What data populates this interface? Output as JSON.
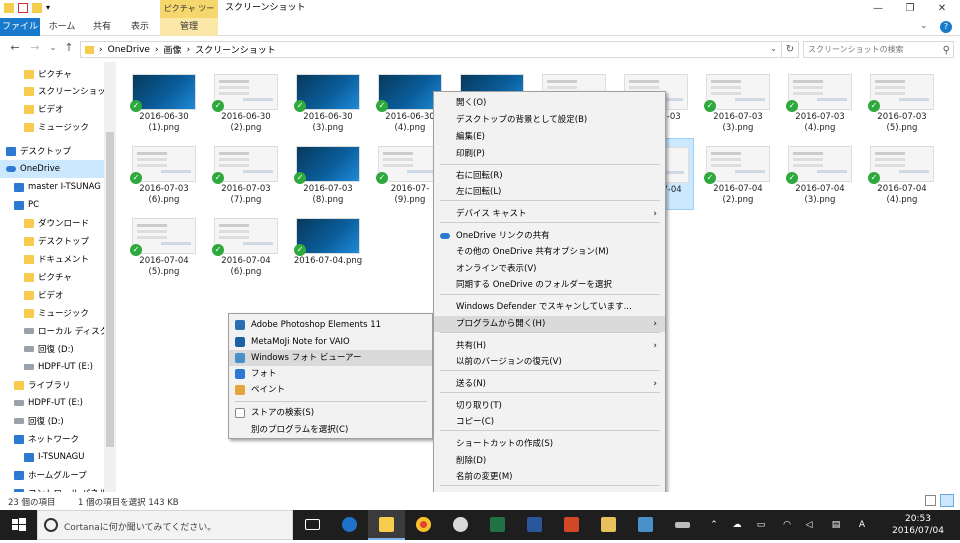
{
  "titlebar": {
    "context_tab": "ピクチャ ツール",
    "title": "スクリーンショット"
  },
  "ribbon": {
    "tabs": [
      "ファイル",
      "ホーム",
      "共有",
      "表示",
      "管理"
    ]
  },
  "address": {
    "path": [
      "OneDrive",
      "画像",
      "スクリーンショット"
    ],
    "search_placeholder": "スクリーンショットの検索"
  },
  "sidebar": {
    "items": [
      {
        "label": "ピクチャ",
        "icon": "pictures-folder-icon"
      },
      {
        "label": "スクリーンショット",
        "icon": "folder-icon"
      },
      {
        "label": "ビデオ",
        "icon": "videos-folder-icon"
      },
      {
        "label": "ミュージック",
        "icon": "music-folder-icon"
      },
      {
        "label": "デスクトップ",
        "icon": "desktop-icon"
      },
      {
        "label": "OneDrive",
        "icon": "onedrive-icon"
      },
      {
        "label": "master I-TSUNAG",
        "icon": "user-icon"
      },
      {
        "label": "PC",
        "icon": "pc-icon"
      },
      {
        "label": "ダウンロード",
        "icon": "downloads-folder-icon"
      },
      {
        "label": "デスクトップ",
        "icon": "desktop-folder-icon"
      },
      {
        "label": "ドキュメント",
        "icon": "documents-folder-icon"
      },
      {
        "label": "ピクチャ",
        "icon": "pictures-folder-icon"
      },
      {
        "label": "ビデオ",
        "icon": "videos-folder-icon"
      },
      {
        "label": "ミュージック",
        "icon": "music-folder-icon"
      },
      {
        "label": "ローカル ディスク (",
        "icon": "local-disk-icon"
      },
      {
        "label": "回復 (D:)",
        "icon": "drive-icon"
      },
      {
        "label": "HDPF-UT (E:)",
        "icon": "drive-icon"
      },
      {
        "label": "ライブラリ",
        "icon": "libraries-icon"
      },
      {
        "label": "HDPF-UT (E:)",
        "icon": "drive-icon"
      },
      {
        "label": "回復 (D:)",
        "icon": "drive-icon"
      },
      {
        "label": "ネットワーク",
        "icon": "network-icon"
      },
      {
        "label": "I-TSUNAGU",
        "icon": "computer-icon"
      },
      {
        "label": "ホームグループ",
        "icon": "homegroup-icon"
      },
      {
        "label": "コントロール パネル",
        "icon": "control-panel-icon"
      }
    ]
  },
  "files": [
    {
      "name": "2016-06-30\n(1).png",
      "style": "dark"
    },
    {
      "name": "2016-06-30\n(2).png",
      "style": "light"
    },
    {
      "name": "2016-06-30\n(3).png",
      "style": "dark"
    },
    {
      "name": "2016-06-30\n(4).png",
      "style": "dark"
    },
    {
      "name": "2016-07-03\n(3).png",
      "style": "light"
    },
    {
      "name": "2016-07-03\n(4).png",
      "style": "light"
    },
    {
      "name": "2016-07-03\n(5).png",
      "style": "light"
    },
    {
      "name": "2016-07-03\n(6).png",
      "style": "light"
    },
    {
      "name": "2016-07-03\n(7).png",
      "style": "light"
    },
    {
      "name": "2016-07-03\n(8).png",
      "style": "dark"
    },
    {
      "name": "2016-07-\n(9).png",
      "style": "light"
    },
    {
      "name": "2016-07-04\n.png",
      "style": "light"
    },
    {
      "name": "2016-07-04\n(2).png",
      "style": "light"
    },
    {
      "name": "2016-07-04\n(3).png",
      "style": "light"
    },
    {
      "name": "2016-07-04\n(4).png",
      "style": "light"
    },
    {
      "name": "2016-07-04\n(5).png",
      "style": "light"
    },
    {
      "name": "2016-07-04\n(6).png",
      "style": "light"
    },
    {
      "name": "2016-07-04.png",
      "style": "dark"
    },
    {
      "name": "",
      "style": "dark"
    },
    {
      "name": "",
      "style": "light"
    },
    {
      "name": "2016-07-03",
      "style": "light"
    }
  ],
  "context_menu": {
    "items": [
      "開く(O)",
      "デスクトップの背景として設定(B)",
      "編集(E)",
      "印刷(P)",
      "右に回転(R)",
      "左に回転(L)",
      "デバイス キャスト",
      "OneDrive リンクの共有",
      "その他の OneDrive 共有オプション(M)",
      "オンラインで表示(V)",
      "同期する OneDrive のフォルダーを選択",
      "Windows Defender でスキャンしています...",
      "プログラムから開く(H)",
      "共有(H)",
      "以前のバージョンの復元(V)",
      "送る(N)",
      "切り取り(T)",
      "コピー(C)",
      "ショートカットの作成(S)",
      "削除(D)",
      "名前の変更(M)",
      "プロパティ(R)"
    ]
  },
  "open_with_menu": {
    "items": [
      {
        "label": "Adobe Photoshop Elements 11",
        "icon": "photoshop-elements-icon",
        "color": "#2a6fb6"
      },
      {
        "label": "MetaMoJi Note for VAIO",
        "icon": "metamoji-note-icon",
        "color": "#1d5fa8"
      },
      {
        "label": "Windows フォト ビューアー",
        "icon": "photo-viewer-icon",
        "color": "#4a90c8"
      },
      {
        "label": "フォト",
        "icon": "photos-icon",
        "color": "#2b79d0"
      },
      {
        "label": "ペイント",
        "icon": "paint-icon",
        "color": "#e6a23c"
      },
      {
        "label": "ストアの検索(S)",
        "icon": "store-icon",
        "color": "#ffffff"
      },
      {
        "label": "別のプログラムを選択(C)",
        "icon": "",
        "color": ""
      }
    ]
  },
  "statusbar": {
    "item_count": "23 個の項目",
    "selection": "1 個の項目を選択  143 KB"
  },
  "taskbar": {
    "cortana_placeholder": "Cortanaに何か聞いてみてください。",
    "ime": "A",
    "time": "20:53",
    "date": "2016/07/04"
  },
  "colors": {
    "file_tab": "#1979ca",
    "context_tab": "#f5d76e",
    "selection": "#cce8ff",
    "check": "#2fa83d"
  }
}
